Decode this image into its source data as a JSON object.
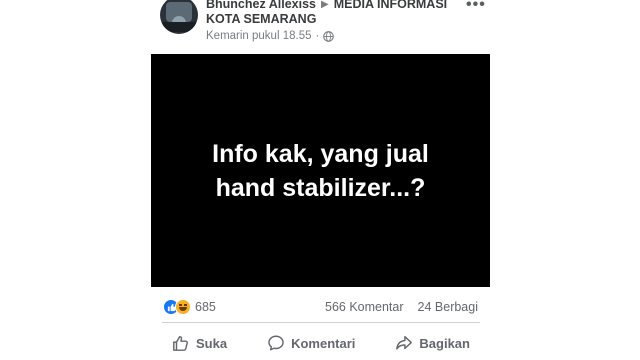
{
  "post": {
    "author": "Bhunchez Allexiss",
    "separator_icon": "triangle-right-icon",
    "group_line1": "MEDIA INFORMASI",
    "group_line2": "KOTA SEMARANG",
    "timestamp": "Kemarin pukul 18.55",
    "meta_separator": "·",
    "privacy_icon": "globe-icon",
    "more_icon": "more-options-icon",
    "more_glyph": "•••",
    "image_text_line1": "Info kak, yang jual",
    "image_text_line2": "hand stabilizer...?"
  },
  "stats": {
    "reaction_icons": [
      "like-icon",
      "haha-icon"
    ],
    "reaction_count": "685",
    "comments": "566 Komentar",
    "shares": "24 Berbagi"
  },
  "actions": {
    "like_label": "Suka",
    "comment_label": "Komentari",
    "share_label": "Bagikan"
  },
  "colors": {
    "like_blue": "#1877f2",
    "haha_yellow": "#f7b125",
    "muted_text": "#65676b",
    "image_bg": "#000000"
  }
}
